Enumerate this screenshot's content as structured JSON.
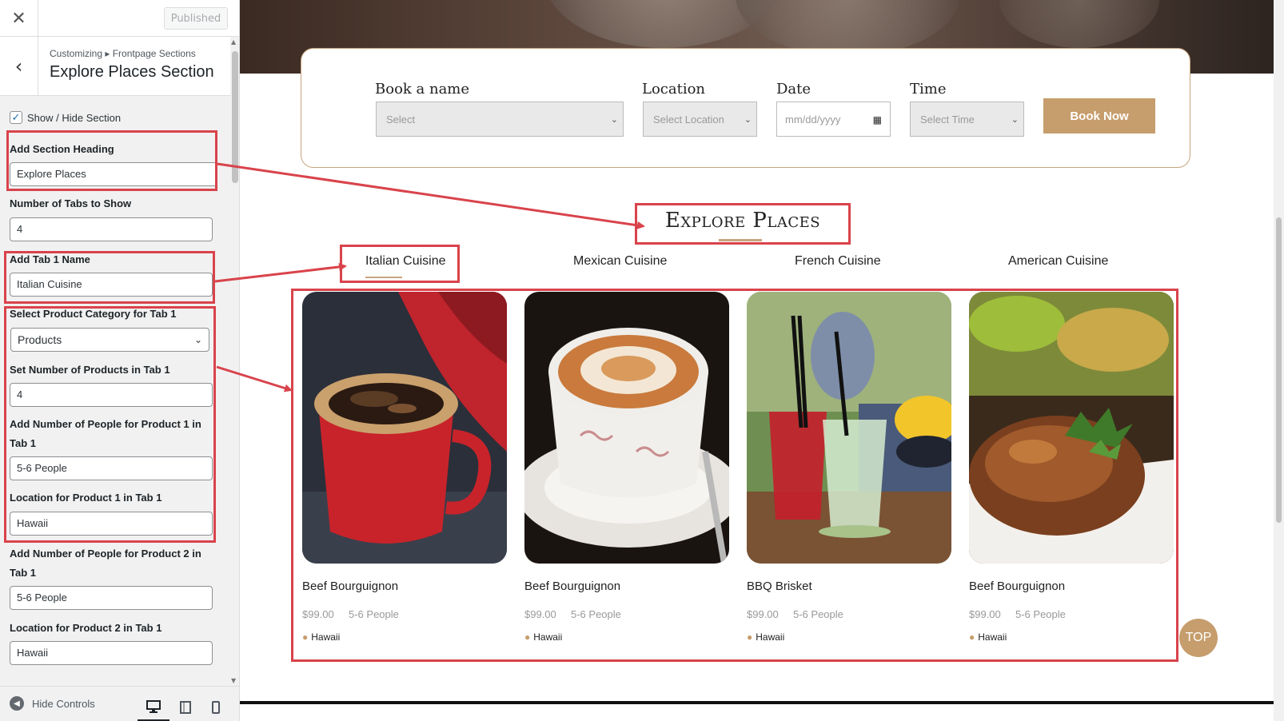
{
  "sidebar": {
    "close_label": "✕",
    "published_label": "Published",
    "breadcrumb": "Customizing ▸ Frontpage Sections",
    "section_title": "Explore Places Section",
    "show_hide_label": "Show / Hide Section",
    "show_hide_checked": "✓",
    "controls": {
      "heading_label": "Add Section Heading",
      "heading_value": "Explore Places",
      "tabs_count_label": "Number of Tabs to Show",
      "tabs_count_value": "4",
      "tab1_name_label": "Add Tab 1 Name",
      "tab1_name_value": "Italian Cuisine",
      "category_label": "Select Product Category for Tab 1",
      "category_value": "Products",
      "num_products_label": "Set Number of Products in Tab 1",
      "num_products_value": "4",
      "p1_people_label": "Add Number of People for Product 1 in Tab 1",
      "p1_people_value": "5-6 People",
      "p1_location_label": "Location for Product 1 in Tab 1",
      "p1_location_value": "Hawaii",
      "p2_people_label": "Add Number of People for Product 2 in Tab 1",
      "p2_people_value": "5-6 People",
      "p2_location_label": "Location for Product 2 in Tab 1",
      "p2_location_value": "Hawaii"
    },
    "footer": {
      "hide_controls_label": "Hide Controls"
    }
  },
  "booking": {
    "name_label": "Book a name",
    "name_placeholder": "Select",
    "location_label": "Location",
    "location_placeholder": "Select Location",
    "date_label": "Date",
    "date_placeholder": "mm/dd/yyyy",
    "time_label": "Time",
    "time_placeholder": "Select Time",
    "book_now": "Book Now"
  },
  "explore": {
    "heading": "Explore Places",
    "tabs": [
      "Italian Cuisine",
      "Mexican Cuisine",
      "French Cuisine",
      "American Cuisine"
    ],
    "products": [
      {
        "name": "Beef Bourguignon",
        "price": "$99.00",
        "people": "5-6 People",
        "location": "Hawaii"
      },
      {
        "name": "Beef Bourguignon",
        "price": "$99.00",
        "people": "5-6 People",
        "location": "Hawaii"
      },
      {
        "name": "BBQ Brisket",
        "price": "$99.00",
        "people": "5-6 People",
        "location": "Hawaii"
      },
      {
        "name": "Beef Bourguignon",
        "price": "$99.00",
        "people": "5-6 People",
        "location": "Hawaii"
      }
    ]
  },
  "top_button": "TOP",
  "colors": {
    "accent": "#c69d6c",
    "annotation": "#d9434b"
  }
}
